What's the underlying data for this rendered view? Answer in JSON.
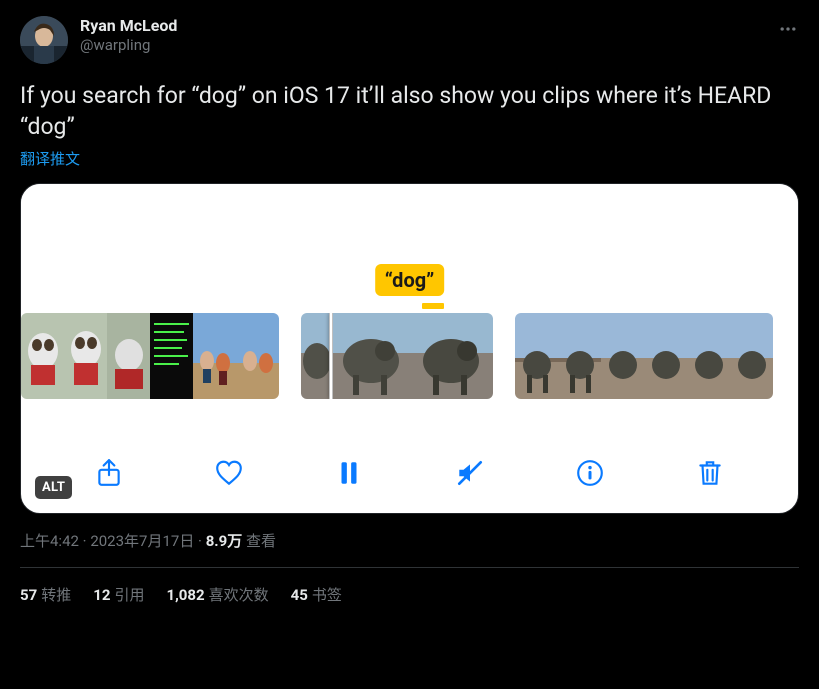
{
  "user": {
    "display_name": "Ryan McLeod",
    "handle": "@warpling"
  },
  "tweet_text": "If you search for “dog” on iOS 17 it’ll also show you clips where it’s HEARD “dog”",
  "translate_label": "翻译推文",
  "caption_text": "“dog”",
  "alt_badge": "ALT",
  "timestamp": "上午4:42",
  "date": "2023年7月17日",
  "sep": " · ",
  "views_count": "8.9万",
  "views_label": " 查看",
  "stats": {
    "retweets_count": "57",
    "retweets_label": "转推",
    "quotes_count": "12",
    "quotes_label": "引用",
    "likes_count": "1,082",
    "likes_label": "喜欢次数",
    "bookmarks_count": "45",
    "bookmarks_label": "书签"
  }
}
